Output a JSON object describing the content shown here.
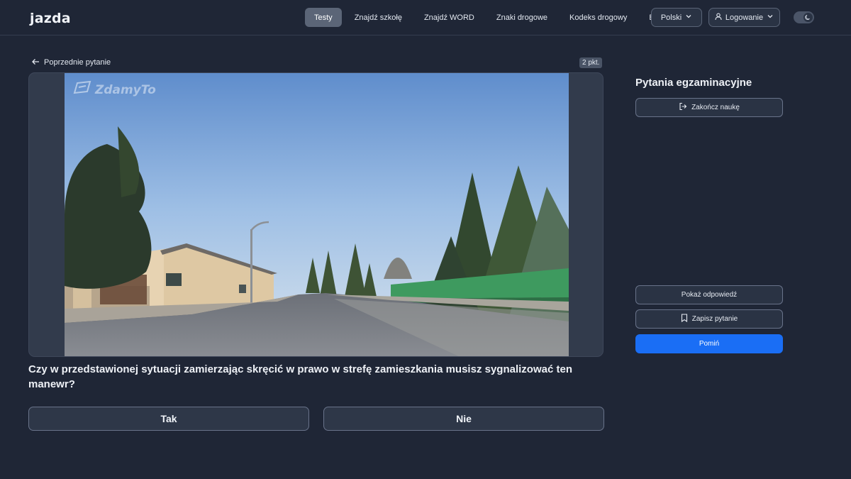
{
  "header": {
    "logo": "jazda",
    "nav": [
      {
        "label": "Testy",
        "active": true
      },
      {
        "label": "Znajdź szkołę",
        "active": false
      },
      {
        "label": "Znajdź WORD",
        "active": false
      },
      {
        "label": "Znaki drogowe",
        "active": false
      },
      {
        "label": "Kodeks drogowy",
        "active": false
      },
      {
        "label": "Blog",
        "active": false
      }
    ],
    "language": "Polski",
    "login": "Logowanie",
    "icons": {
      "language_chevron": "chevron-down-icon",
      "login_user": "user-icon",
      "theme": "moon-icon"
    }
  },
  "main": {
    "back_label": "Poprzednie pytanie",
    "points": "2 pkt.",
    "watermark": "ZdamyTo",
    "question": "Czy w przedstawionej sytuacji zamierzając skręcić w prawo w strefę zamieszkania musisz sygnalizować ten manewr?",
    "answers": [
      "Tak",
      "Nie"
    ]
  },
  "sidebar": {
    "title": "Pytania egzaminacyjne",
    "end_label": "Zakończ naukę",
    "show_answer_label": "Pokaż odpowiedź",
    "save_label": "Zapisz pytanie",
    "skip_label": "Pomiń"
  },
  "colors": {
    "background": "#1f2636",
    "accent": "#1a6ef5",
    "active_nav": "#5b6577"
  }
}
